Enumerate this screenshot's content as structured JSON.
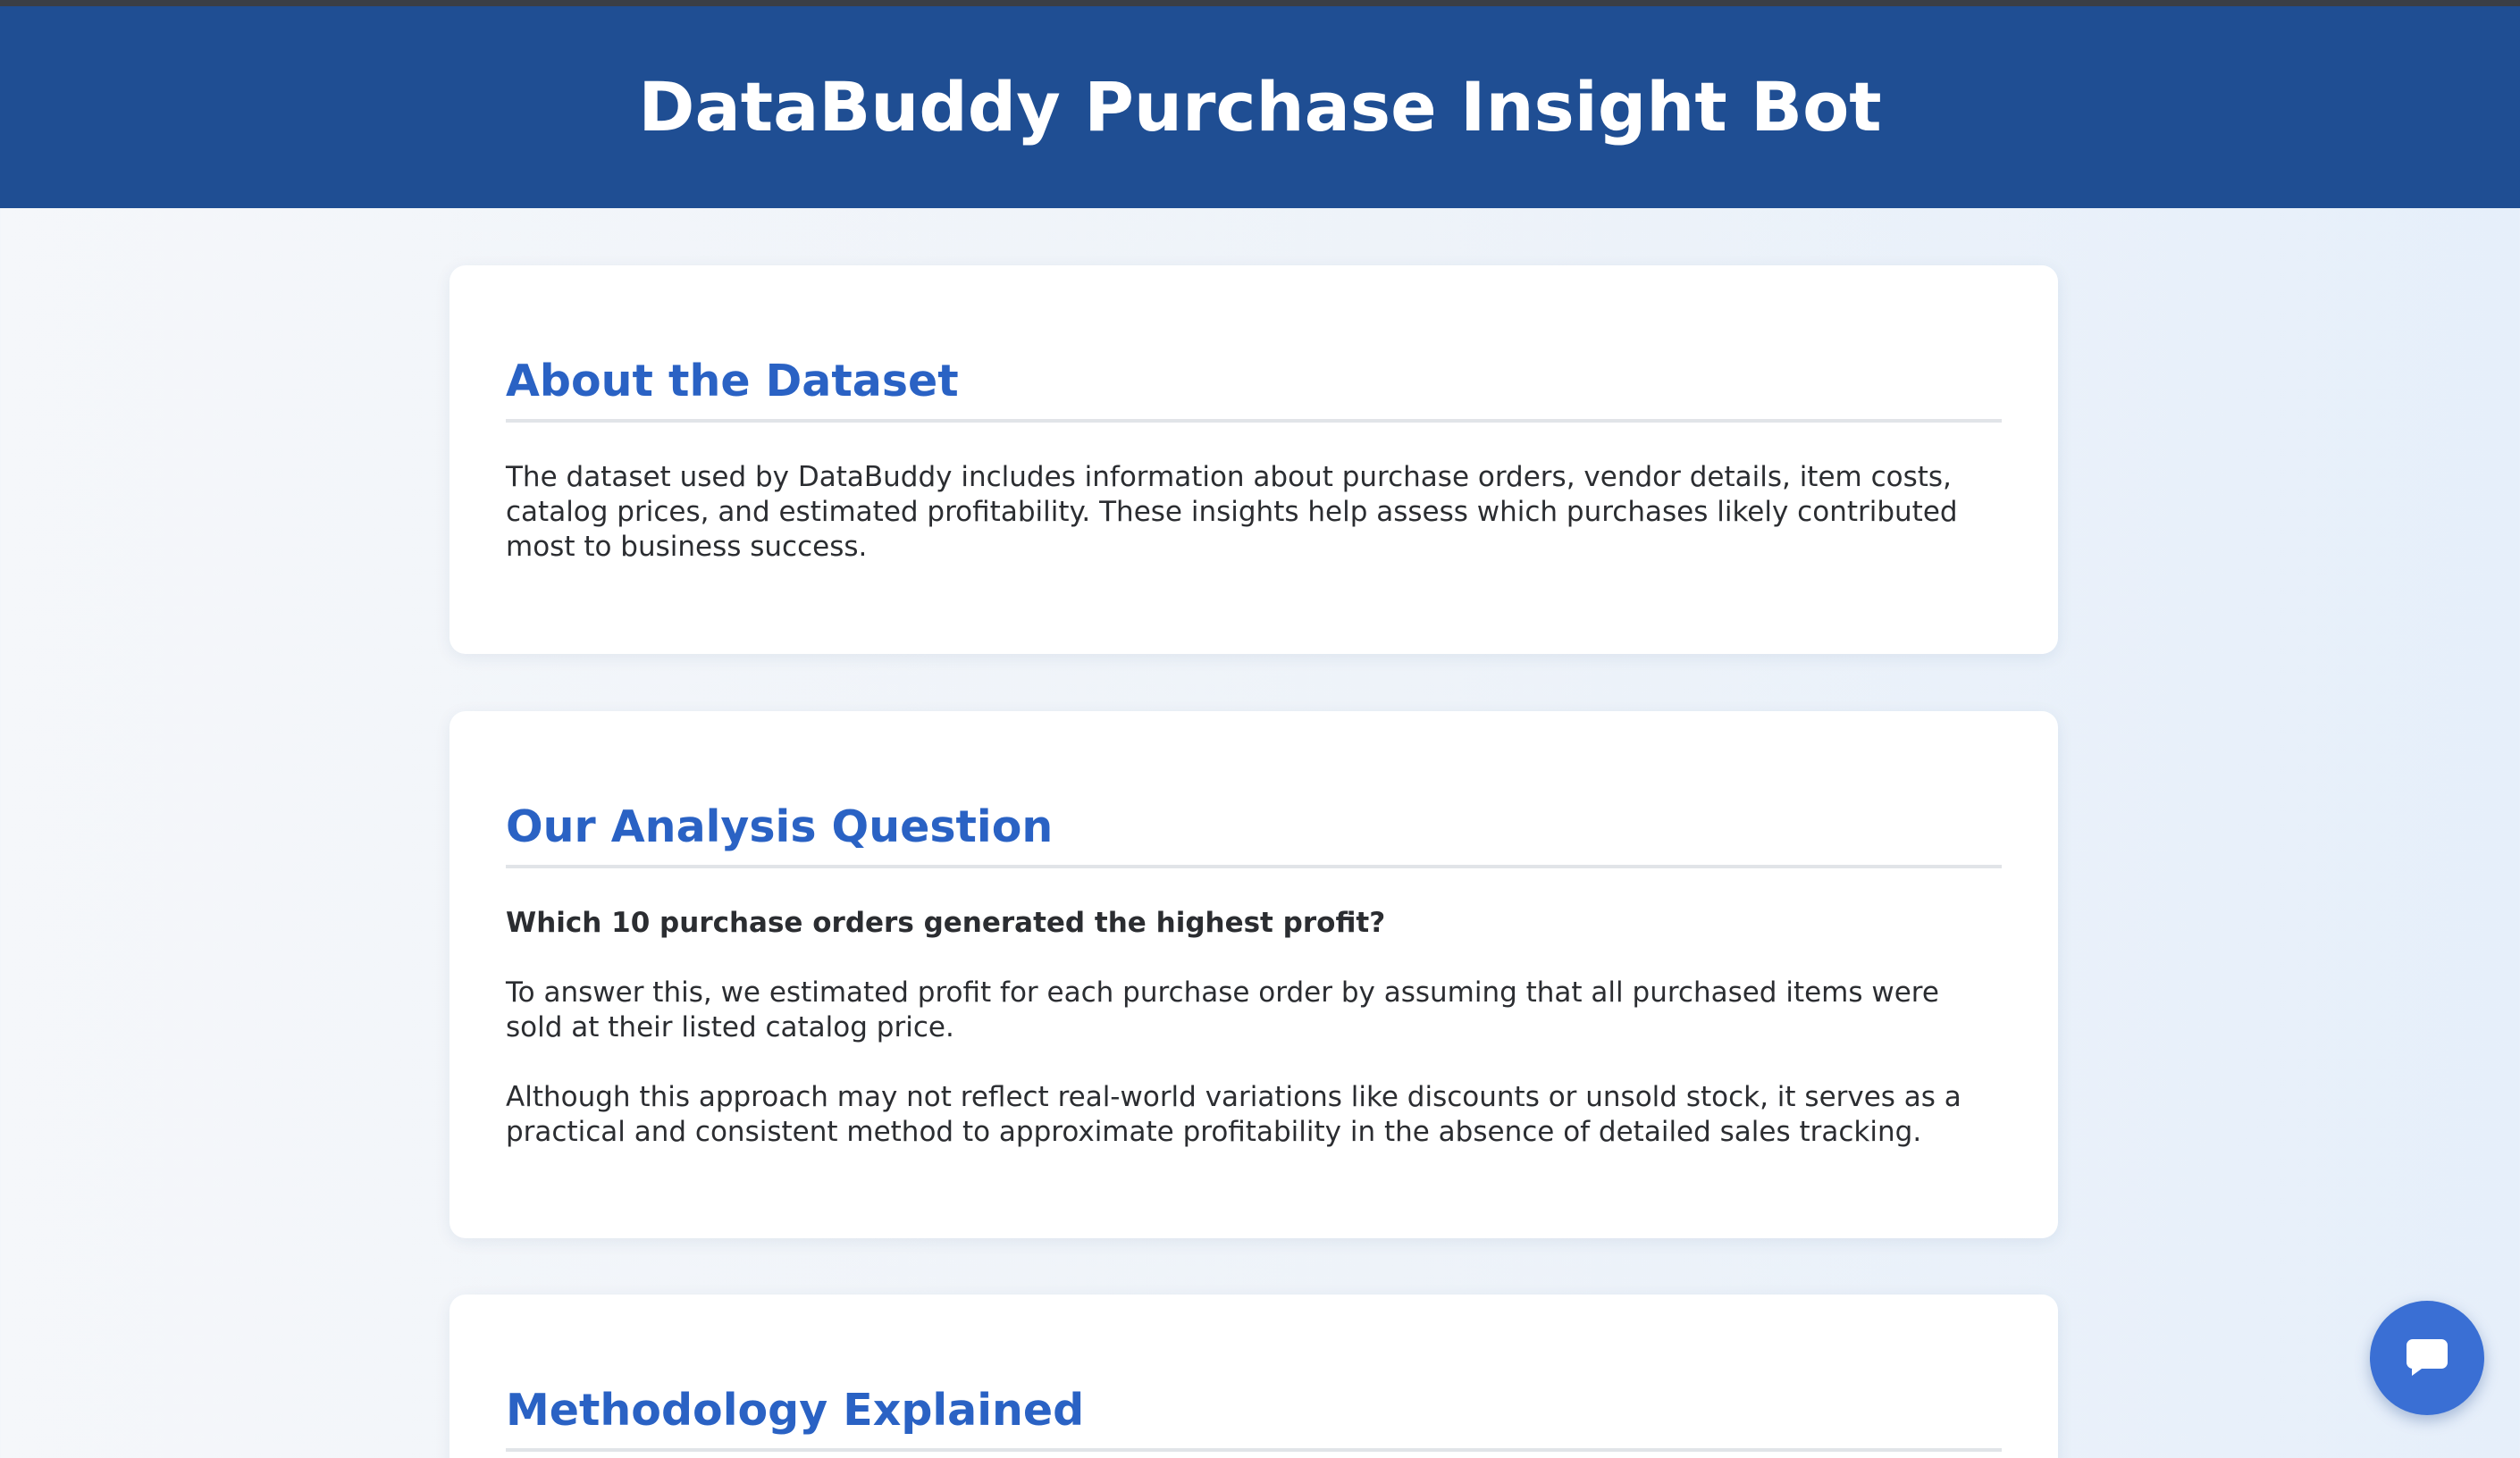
{
  "header": {
    "title": "DataBuddy Purchase Insight Bot"
  },
  "sections": [
    {
      "heading": "About the Dataset",
      "paragraphs": [
        "The dataset used by DataBuddy includes information about purchase orders, vendor details, item costs, catalog prices, and estimated profitability. These insights help assess which purchases likely contributed most to business success."
      ]
    },
    {
      "heading": "Our Analysis Question",
      "question": "Which 10 purchase orders generated the highest profit?",
      "paragraphs": [
        "To answer this, we estimated profit for each purchase order by assuming that all purchased items were sold at their listed catalog price.",
        "Although this approach may not reflect real-world variations like discounts or unsold stock, it serves as a practical and consistent method to approximate profitability in the absence of detailed sales tracking."
      ]
    },
    {
      "heading": "Methodology Explained"
    }
  ],
  "chat_button": {
    "icon": "chat-bubble-icon"
  },
  "colors": {
    "header_bg": "#1f4e93",
    "heading": "#2a62c4",
    "chat_button": "#3a6fd4"
  }
}
